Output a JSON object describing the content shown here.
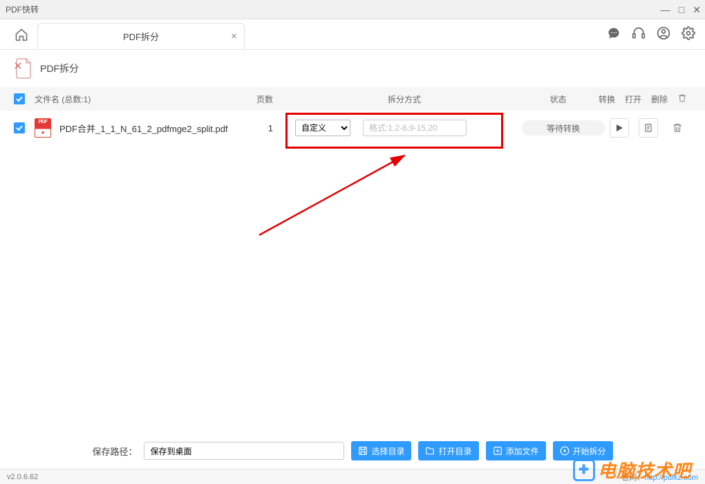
{
  "window": {
    "title": "PDF快转"
  },
  "tab": {
    "label": "PDF拆分"
  },
  "section": {
    "title": "PDF拆分"
  },
  "columns": {
    "filename": "文件名 (总数:1)",
    "pages": "页数",
    "split_method": "拆分方式",
    "status": "状态",
    "convert": "转换",
    "open": "打开",
    "delete": "删除"
  },
  "row": {
    "filename": "PDF合并_1_1_N_61_2_pdfmge2_split.pdf",
    "pages": "1",
    "split_mode": "自定义",
    "range_placeholder": "格式:1,2-8,9-15,20",
    "status": "等待转换"
  },
  "footer": {
    "path_label": "保存路径：",
    "path_value": "保存到桌面",
    "choose_dir": "选择目录",
    "open_dir": "打开目录",
    "add_file": "添加文件",
    "start_split": "开始拆分"
  },
  "statusbar": {
    "version": "v2.0.6.62",
    "site_label": "官网：",
    "site_url": "http://pdfkz.com"
  },
  "watermark": "电脑技术吧"
}
